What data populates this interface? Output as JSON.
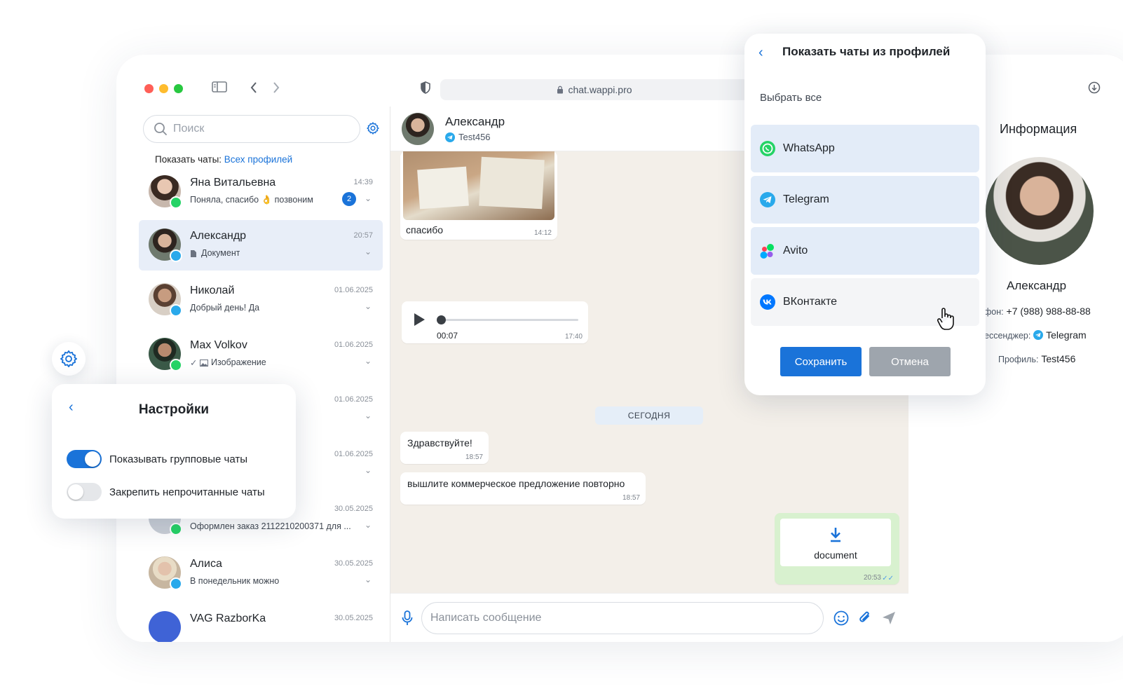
{
  "browser": {
    "url": "chat.wappi.pro"
  },
  "sidebar": {
    "search_placeholder": "Поиск",
    "show_chats_label": "Показать чаты:",
    "show_chats_value": "Всех профилей",
    "chats": [
      {
        "name": "Яна Витальевна",
        "time": "14:39",
        "preview": "Поняла, спасибо 👌 позвоним",
        "unread": "2",
        "messenger": "whatsapp"
      },
      {
        "name": "Александр",
        "time": "20:57",
        "preview": "Документ",
        "messenger": "telegram",
        "active": true
      },
      {
        "name": "Николай",
        "time": "01.06.2025",
        "preview": "Добрый день! Да",
        "messenger": "telegram"
      },
      {
        "name": "Max Volkov",
        "time": "01.06.2025",
        "preview": "Изображение",
        "messenger": "whatsapp"
      },
      {
        "name": "",
        "time": "01.06.2025",
        "preview": ""
      },
      {
        "name": "",
        "time": "01.06.2025",
        "preview": ""
      },
      {
        "name": "",
        "time": "30.05.2025",
        "preview": "Оформлен заказ 2112210200371 для ...",
        "messenger": "whatsapp"
      },
      {
        "name": "Алиса",
        "time": "30.05.2025",
        "preview": "В понедельник можно",
        "messenger": "telegram"
      },
      {
        "name": "VAG RazborKa",
        "time": "30.05.2025",
        "preview": ""
      }
    ]
  },
  "chat": {
    "contact_name": "Александр",
    "contact_profile": "Test456",
    "messages": {
      "photo_caption": "спасибо",
      "photo_time": "14:12",
      "voice_duration": "00:07",
      "voice_time": "17:40",
      "date_separator": "СЕГОДНЯ",
      "msg1_text": "Здравствуйте!",
      "msg1_time": "18:57",
      "msg2_text": "вышлите коммерческое предложение повторно",
      "msg2_time": "18:57",
      "doc_label": "document",
      "doc_time": "20:53"
    },
    "composer_placeholder": "Написать сообщение"
  },
  "info": {
    "title": "Информация",
    "name": "Александр",
    "phone_label": "фон:",
    "phone": "+7 (988) 988-88-88",
    "messenger_label": "ессенджер:",
    "messenger": "Telegram",
    "profile_label": "Профиль:",
    "profile": "Test456"
  },
  "profiles_popup": {
    "title": "Показать чаты из профилей",
    "select_all": "Выбрать все",
    "items": [
      {
        "label": "WhatsApp",
        "selected": true
      },
      {
        "label": "Telegram",
        "selected": true
      },
      {
        "label": "Avito",
        "selected": true
      },
      {
        "label": "ВКонтакте",
        "selected": false
      }
    ],
    "save_label": "Сохранить",
    "cancel_label": "Отмена"
  },
  "settings_popup": {
    "title": "Настройки",
    "options": [
      {
        "label": "Показывать групповые чаты",
        "enabled": true
      },
      {
        "label": "Закрепить непрочитанные чаты",
        "enabled": false
      }
    ]
  },
  "colors": {
    "accent": "#1a73d9",
    "whatsapp": "#25d366",
    "telegram": "#29a9eb",
    "vk": "#0077ff"
  }
}
